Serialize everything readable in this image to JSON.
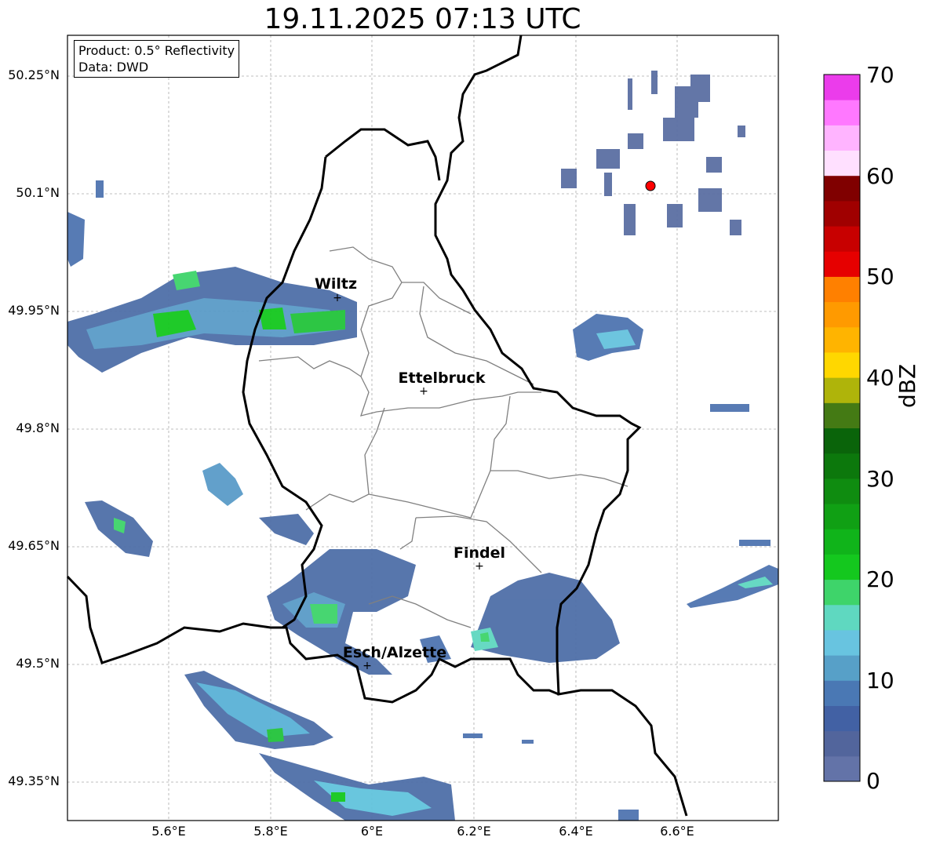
{
  "title": "19.11.2025 07:13 UTC",
  "info_box": {
    "product": "Product: 0.5° Reflectivity",
    "data": "Data: DWD"
  },
  "lat_ticks": [
    "50.25°N",
    "50.1°N",
    "49.95°N",
    "49.8°N",
    "49.65°N",
    "49.5°N",
    "49.35°N"
  ],
  "lon_ticks": [
    "5.6°E",
    "5.8°E",
    "6°E",
    "6.2°E",
    "6.4°E",
    "6.6°E"
  ],
  "cities": [
    {
      "name": "Wiltz"
    },
    {
      "name": "Ettelbruck"
    },
    {
      "name": "Findel"
    },
    {
      "name": "Esch/Alzette"
    }
  ],
  "colorbar": {
    "label": "dBZ",
    "ticks": [
      "0",
      "10",
      "20",
      "30",
      "40",
      "50",
      "60",
      "70"
    ],
    "colors": [
      "#6373a8",
      "#52659c",
      "#4261a4",
      "#4a78b4",
      "#57a0c8",
      "#68c4e0",
      "#5fd8c0",
      "#3ed46a",
      "#14c81e",
      "#10b41a",
      "#10a014",
      "#0f8c10",
      "#0c780c",
      "#0a640a",
      "#447a14",
      "#afb40a",
      "#ffd700",
      "#ffb400",
      "#ff9a00",
      "#ff8000",
      "#e60000",
      "#c80000",
      "#a00000",
      "#800000",
      "#ffe0ff",
      "#ffb4ff",
      "#ff78ff",
      "#eb3ceb"
    ]
  },
  "radar_site": {
    "color": "#ff0000"
  }
}
